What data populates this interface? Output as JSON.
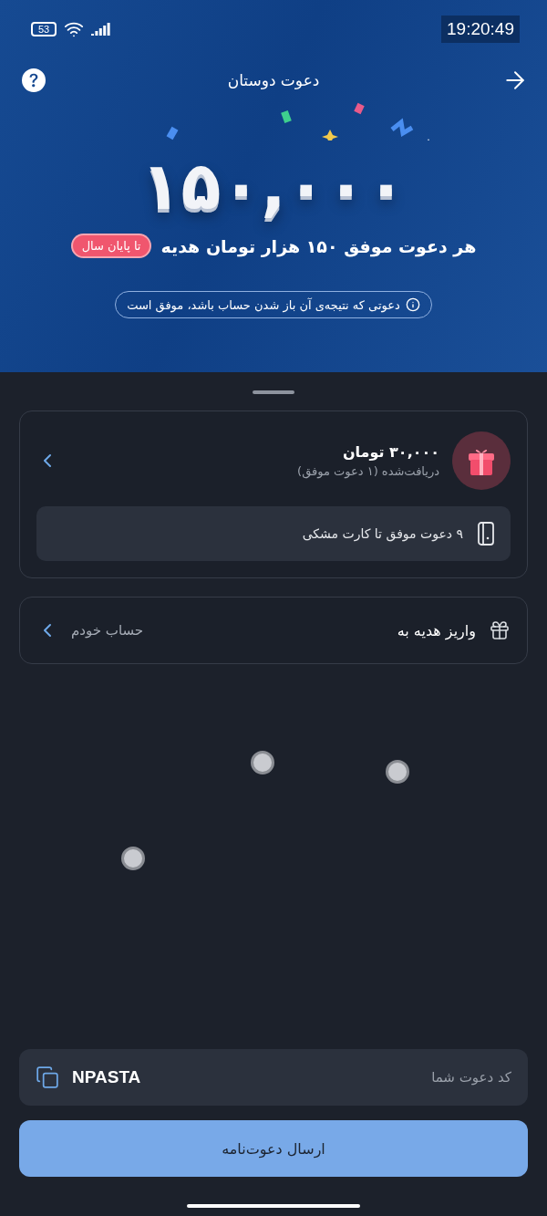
{
  "status_bar": {
    "time": "19:20:49",
    "battery": "53"
  },
  "header": {
    "title": "دعوت دوستان"
  },
  "hero": {
    "amount": "۱۵۰,۰۰۰",
    "headline": "هر دعوت موفق ۱۵۰ هزار تومان هدیه",
    "badge": "تا پایان سال",
    "note": "دعوتی که نتیجه‌ی آن باز شدن حساب باشد، موفق است"
  },
  "reward_card": {
    "amount": "۳۰,۰۰۰ تومان",
    "caption": "دریافت‌شده (۱ دعوت موفق)",
    "progress_note": "۹ دعوت موفق تا کارت مشکی"
  },
  "deposit_row": {
    "label": "واریز هدیه به",
    "value": "حساب خودم"
  },
  "invite_code": {
    "label": "کد دعوت شما",
    "code": "NPASTA"
  },
  "send_button": "ارسال دعوت‌نامه"
}
